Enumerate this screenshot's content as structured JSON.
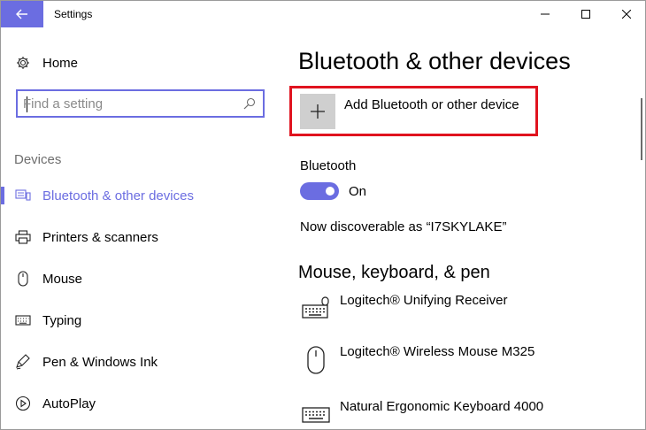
{
  "window": {
    "title": "Settings"
  },
  "sidebar": {
    "home_label": "Home",
    "search_placeholder": "Find a setting",
    "section": "Devices",
    "items": [
      {
        "label": "Bluetooth & other devices",
        "icon": "bluetooth-devices-icon",
        "active": true
      },
      {
        "label": "Printers & scanners",
        "icon": "printer-icon"
      },
      {
        "label": "Mouse",
        "icon": "mouse-icon"
      },
      {
        "label": "Typing",
        "icon": "keyboard-icon"
      },
      {
        "label": "Pen & Windows Ink",
        "icon": "pen-icon"
      },
      {
        "label": "AutoPlay",
        "icon": "autoplay-icon"
      }
    ]
  },
  "main": {
    "title": "Bluetooth & other devices",
    "add_device_label": "Add Bluetooth or other device",
    "bluetooth_label": "Bluetooth",
    "bluetooth_state": "On",
    "discoverable_text": "Now discoverable as “I7SKYLAKE”",
    "devices_heading": "Mouse, keyboard, & pen",
    "devices": [
      {
        "name": "Logitech® Unifying Receiver",
        "icon": "keyboard-mouse-icon"
      },
      {
        "name": "Logitech® Wireless Mouse M325",
        "icon": "mouse-icon"
      },
      {
        "name": "Natural Ergonomic Keyboard 4000",
        "icon": "keyboard-icon"
      }
    ]
  },
  "colors": {
    "accent": "#6b6de1",
    "highlight": "#e0131f"
  }
}
